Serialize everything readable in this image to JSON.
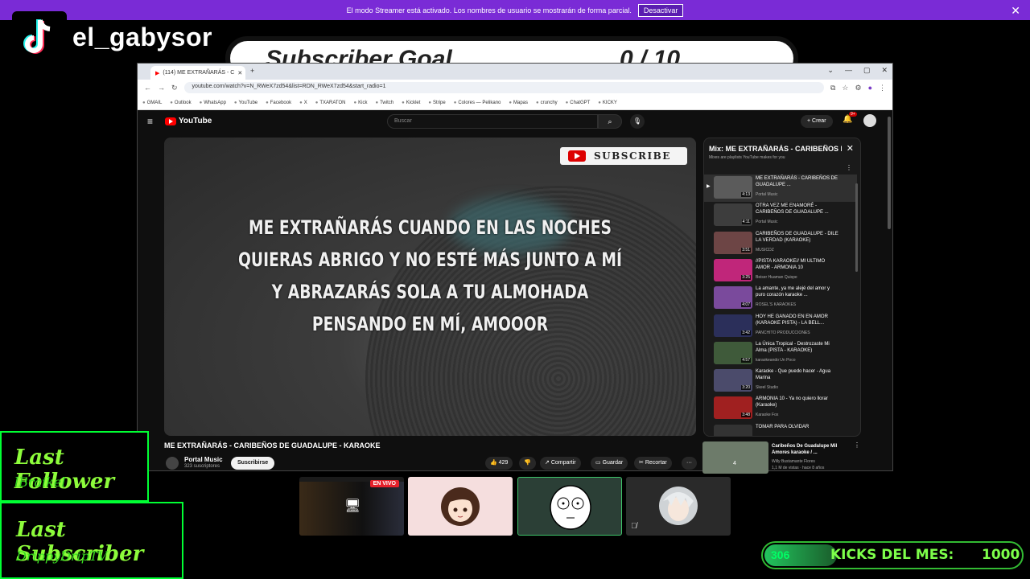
{
  "streamer_banner": {
    "text": "El modo Streamer está activado. Los nombres de usuario se mostrarán de forma parcial.",
    "button": "Desactivar",
    "close": "✕"
  },
  "overlay": {
    "username": "el_gabysor",
    "goal_left": "Subscriber Goal",
    "goal_right": "0 / 10"
  },
  "browser": {
    "tab_title": "(114) ME EXTRAÑARÁS - C",
    "url": "youtube.com/watch?v=N_RWeX7zd54&list=RDN_RWeX7zd54&start_radio=1",
    "bookmarks": [
      "GMAIL",
      "Outlook",
      "WhatsApp",
      "YouTube",
      "Facebook",
      "X",
      "TXARATON",
      "Kick",
      "Twitch",
      "Kicklet",
      "Stripe",
      "Colores — Pelikano",
      "Mapas",
      "crunchy",
      "ChatGPT",
      "KICKY"
    ]
  },
  "youtube": {
    "logo": "YouTube",
    "search_placeholder": "Buscar",
    "create": "+ Crear",
    "notif_count": "9+",
    "video": {
      "subscribe_badge": "SUBSCRIBE",
      "lyrics": [
        "ME EXTRAÑARÁS CUANDO EN LAS NOCHES",
        "QUIERAS ABRIGO Y NO ESTÉ MÁS JUNTO A MÍ",
        "Y ABRAZARÁS SOLA A TU ALMOHADA",
        "PENSANDO EN MÍ, AMOOOR"
      ],
      "title": "ME EXTRAÑARÁS - CARIBEÑOS DE GUADALUPE - KARAOKE",
      "channel": "Portal Music",
      "subs": "323 suscriptores",
      "subscribe_btn": "Suscribirse",
      "likes": "429",
      "share": "Compartir",
      "save": "Guardar",
      "clip": "Recortar",
      "more": "···"
    },
    "playlist": {
      "title": "Mix: ME EXTRAÑARÁS - CARIBEÑOS DE GUADALUPE",
      "subtitle": "Mixes are playlists YouTube makes for you",
      "items": [
        {
          "title": "ME EXTRAÑARÁS - CARIBEÑOS DE GUADALUPE ...",
          "channel": "Portal Music",
          "duration": "4:13",
          "color": "#5b5b5b"
        },
        {
          "title": "OTRA VEZ ME ENAMORÉ - CARIBEÑOS DE GUADALUPE ...",
          "channel": "Portal Music",
          "duration": "4:11",
          "color": "#3d3d3d"
        },
        {
          "title": "CARIBEÑOS DE GUADALUPE - DILE LA VERDAD (KARAOKE)",
          "channel": "MUSICDZ",
          "duration": "3:51",
          "color": "#6d4545"
        },
        {
          "title": "//PISTA KARAOKE// MI ULTIMO AMOR - ARMONIA 10",
          "channel": "Beiser Huaman Quispe",
          "duration": "3:25",
          "color": "#c0267a"
        },
        {
          "title": "La amante, ya me alejé del amor y puro corazón karaoke ...",
          "channel": "ROSEL'S KARAOKES",
          "duration": "4:07",
          "color": "#7a4a9c"
        },
        {
          "title": "HOY HE GANADO EN EN AMOR (KARAOKE PISTA) - LA BELL...",
          "channel": "PANCHITO PRODUCCIONES",
          "duration": "3:42",
          "color": "#2b2f5a"
        },
        {
          "title": "La Única Tropical - Destrozaste Mi Alma (PISTA - KARAOKE)",
          "channel": "karaokeando Un Poco",
          "duration": "4:57",
          "color": "#3f5a3a"
        },
        {
          "title": "Karaoke - Que puedo hacer - Agua Marina",
          "channel": "Skeel Studio",
          "duration": "3:20",
          "color": "#4b4b6b"
        },
        {
          "title": "ARMONIA 10 - Ya no quiero llorar (Karaoke)",
          "channel": "Karaoke Fox",
          "duration": "3:48",
          "color": "#a02020"
        },
        {
          "title": "TOMAR PARA OLVIDAR",
          "channel": "",
          "duration": "",
          "color": "#333"
        }
      ]
    },
    "recommendation": {
      "title": "Caribeños De Guadalupe  Mil Amores   karaoke / ...",
      "channel": "Willy Bustamante Flores",
      "meta": "1,1 M de vistas · hace 8 años",
      "badge": "4"
    }
  },
  "stream": {
    "last_follower_label": "Last Follower",
    "last_follower": "lBraikel",
    "last_subscriber_label": "Last Subscriber",
    "last_subscriber": "DrippyDripTV",
    "live_badge": "EN VIVO",
    "kicks_current": "306",
    "kicks_label": "KICKS DEL MES:",
    "kicks_goal": "1000"
  }
}
